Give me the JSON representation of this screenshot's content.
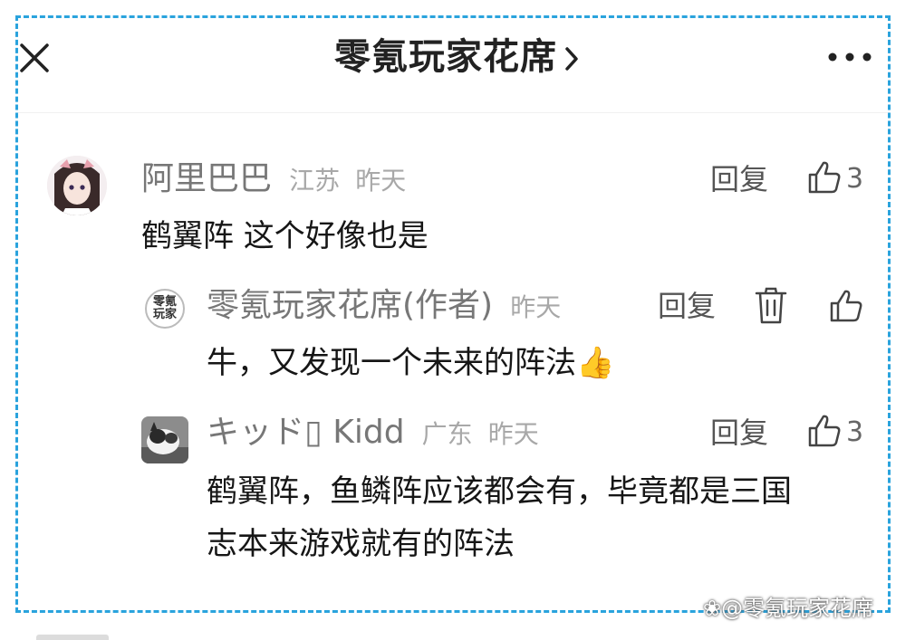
{
  "header": {
    "title": "零氪玩家花席"
  },
  "comments": [
    {
      "username": "阿里巴巴",
      "location": "江苏",
      "time": "昨天",
      "text": "鹤翼阵 这个好像也是",
      "reply_label": "回复",
      "likes": "3"
    },
    {
      "username": "零氪玩家花席(作者)",
      "avatar_text_top": "零氪",
      "avatar_text_bottom": "玩家",
      "time": "昨天",
      "text": "牛，又发现一个未来的阵法👍",
      "reply_label": "回复"
    },
    {
      "username": "キッド▯ Kidd",
      "location": "广东",
      "time": "昨天",
      "text_line1": "鹤翼阵，鱼鳞阵应该都会有，毕竟都是三国",
      "text_line2": "志本来游戏就有的阵法",
      "reply_label": "回复",
      "likes": "3"
    }
  ],
  "watermark": "❀@零氪玩家花席"
}
